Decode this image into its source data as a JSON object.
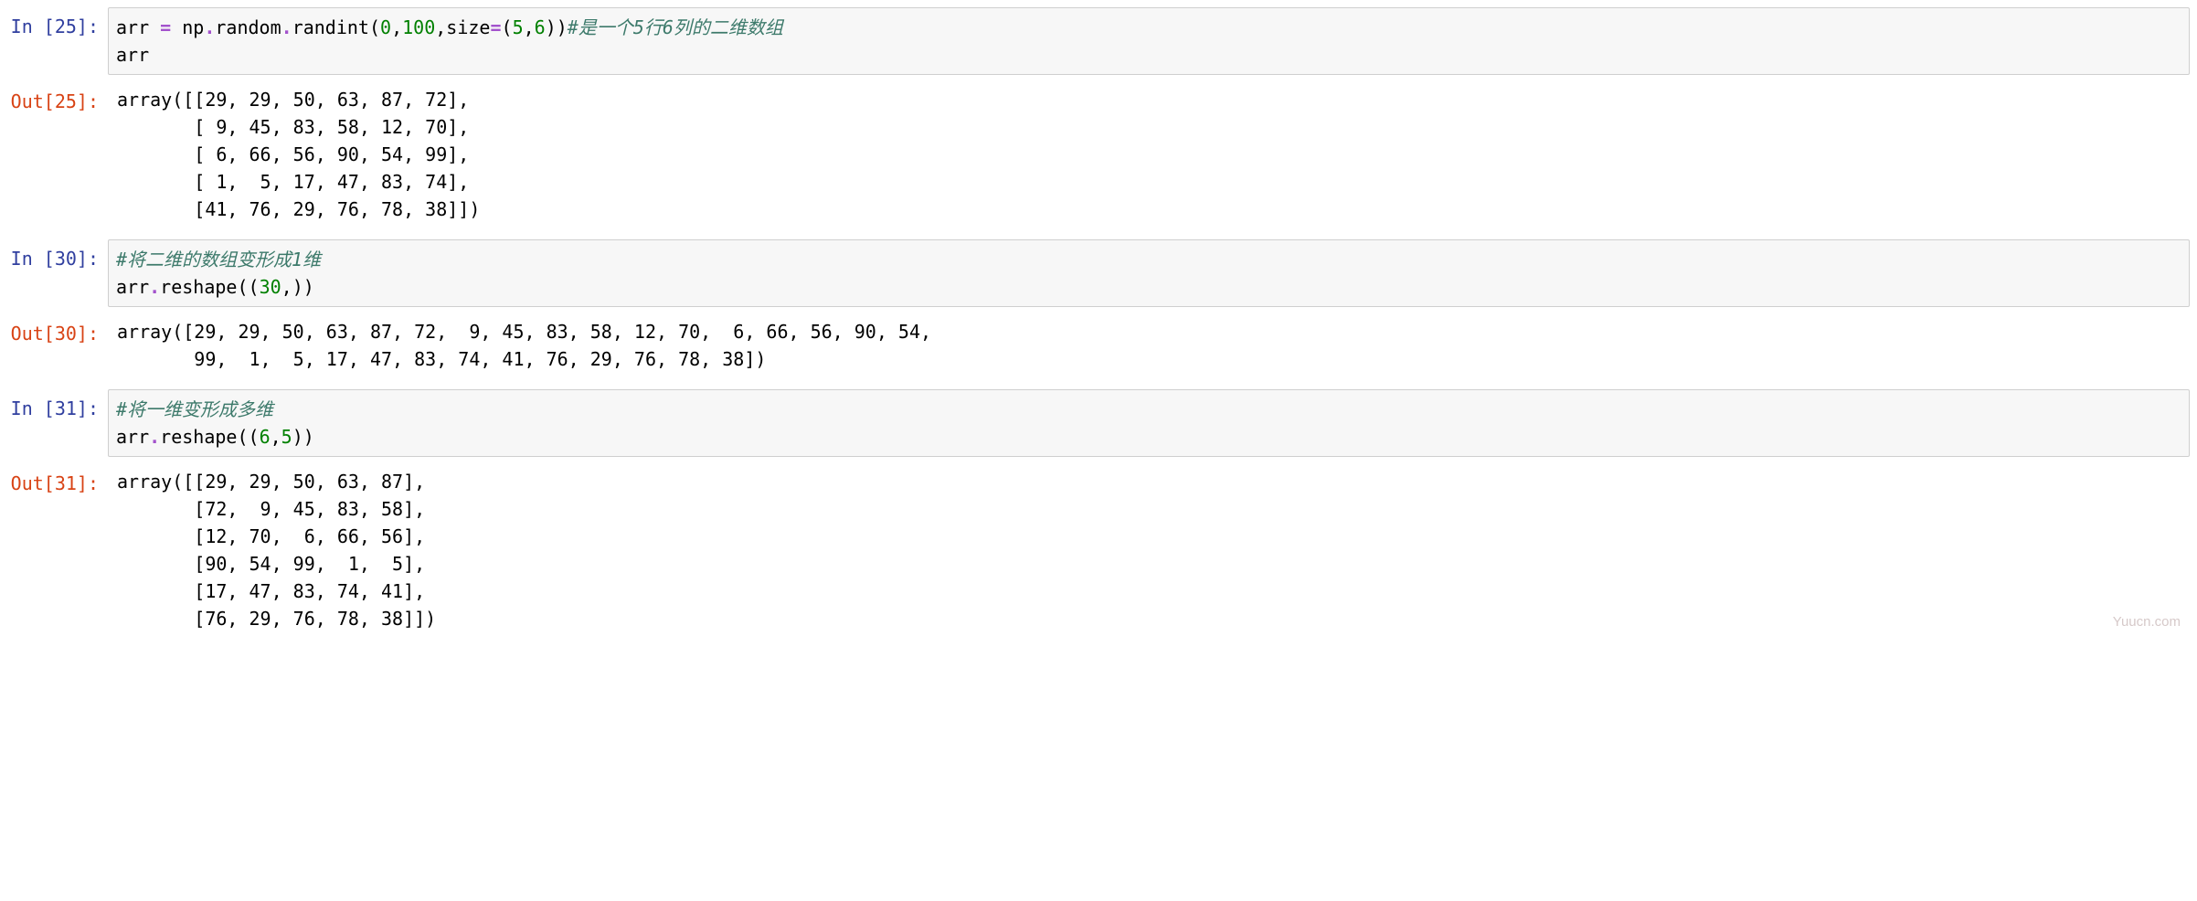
{
  "cells": [
    {
      "prompt_in": "In [25]:",
      "prompt_out": "Out[25]:",
      "code": {
        "line1": {
          "var": "arr ",
          "op1": "=",
          "sp1": " np",
          "dot1": ".",
          "rand": "random",
          "dot2": ".",
          "func": "randint",
          "open": "(",
          "n0": "0",
          "comma1": ",",
          "n100": "100",
          "comma2": ",",
          "size": "size",
          "eq2": "=",
          "open2": "(",
          "n5": "5",
          "comma3": ",",
          "n6": "6",
          "close2": "))",
          "comment": "#是一个5行6列的二维数组"
        },
        "line2": "arr"
      },
      "output": "array([[29, 29, 50, 63, 87, 72],\n       [ 9, 45, 83, 58, 12, 70],\n       [ 6, 66, 56, 90, 54, 99],\n       [ 1,  5, 17, 47, 83, 74],\n       [41, 76, 29, 76, 78, 38]])"
    },
    {
      "prompt_in": "In [30]:",
      "prompt_out": "Out[30]:",
      "code": {
        "line1_comment": "#将二维的数组变形成1维",
        "line2": {
          "var": "arr",
          "dot": ".",
          "func": "reshape",
          "open": "((",
          "n30": "30",
          "comma": ",",
          "close": "))"
        }
      },
      "output": "array([29, 29, 50, 63, 87, 72,  9, 45, 83, 58, 12, 70,  6, 66, 56, 90, 54,\n       99,  1,  5, 17, 47, 83, 74, 41, 76, 29, 76, 78, 38])"
    },
    {
      "prompt_in": "In [31]:",
      "prompt_out": "Out[31]:",
      "code": {
        "line1_comment": "#将一维变形成多维",
        "line2": {
          "var": "arr",
          "dot": ".",
          "func": "reshape",
          "open": "((",
          "n6": "6",
          "comma": ",",
          "n5": "5",
          "close": "))"
        }
      },
      "output": "array([[29, 29, 50, 63, 87],\n       [72,  9, 45, 83, 58],\n       [12, 70,  6, 66, 56],\n       [90, 54, 99,  1,  5],\n       [17, 47, 83, 74, 41],\n       [76, 29, 76, 78, 38]])"
    }
  ],
  "watermark": "Yuucn.com"
}
